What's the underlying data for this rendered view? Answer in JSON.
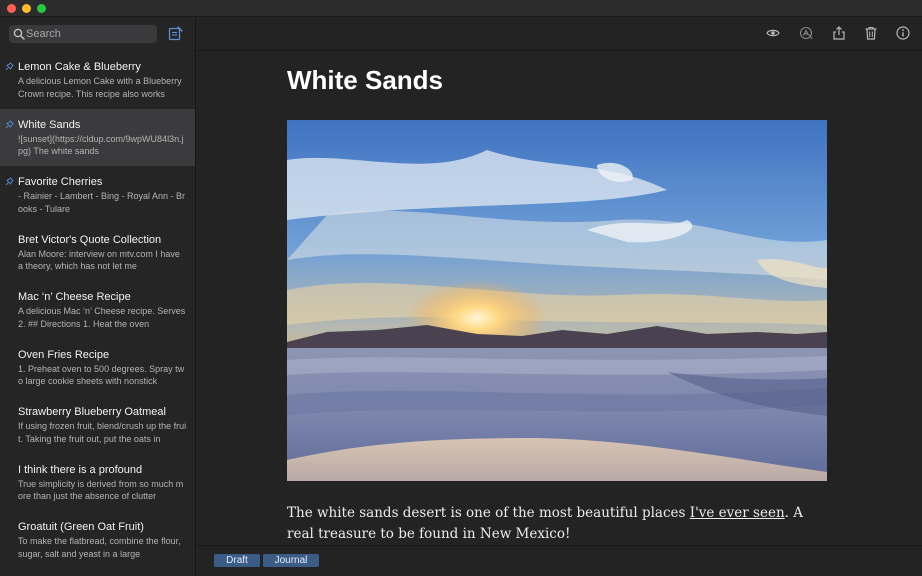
{
  "search": {
    "placeholder": "Search"
  },
  "notes": [
    {
      "title": "Lemon Cake & Blueberry",
      "preview": "A delicious Lemon Cake with a Blueberry Crown recipe. This recipe also works",
      "pinned": true,
      "selected": false
    },
    {
      "title": "White Sands",
      "preview": "![sunset](https://cldup.com/9wpWU84l3n.jpg) The white sands",
      "pinned": true,
      "selected": true
    },
    {
      "title": "Favorite Cherries",
      "preview": "- Rainier - Lambert - Bing - Royal Ann - Brooks - Tulare",
      "pinned": true,
      "selected": false
    },
    {
      "title": "Bret Victor's Quote Collection",
      "preview": "Alan Moore: interview on mtv.com  I have a theory, which has not let me",
      "pinned": false,
      "selected": false
    },
    {
      "title": "Mac ‘n’ Cheese Recipe",
      "preview": "A delicious Mac ‘n’ Cheese recipe. Serves 2. ## Directions 1. Heat the oven",
      "pinned": false,
      "selected": false
    },
    {
      "title": "Oven Fries Recipe",
      "preview": "1. Preheat oven to 500 degrees. Spray two large cookie sheets with nonstick",
      "pinned": false,
      "selected": false
    },
    {
      "title": "Strawberry Blueberry Oatmeal",
      "preview": "If using frozen fruit, blend/crush up the fruit. Taking the fruit out, put the oats in",
      "pinned": false,
      "selected": false
    },
    {
      "title": "I think there is a profound",
      "preview": "True simplicity is derived from so much more than just the absence of clutter",
      "pinned": false,
      "selected": false
    },
    {
      "title": "Groatuit (Green Oat Fruit)",
      "preview": "To make the flatbread, combine the flour, sugar, salt and yeast in a large",
      "pinned": false,
      "selected": false
    }
  ],
  "toolbar": {
    "icons": [
      "eye-icon",
      "markdown-icon",
      "share-icon",
      "trash-icon",
      "info-icon"
    ]
  },
  "editor": {
    "title": "White Sands",
    "image_icon": "sunset-photo",
    "body_before": "The white sands desert is one of the most beautiful places ",
    "body_link": "I've ever seen",
    "body_after": ". A real treasure to be found in New Mexico!"
  },
  "tags": [
    "Draft",
    "Journal"
  ],
  "colors": {
    "accent": "#3b5c86",
    "pin": "#5b8fd6",
    "selected_row": "#3b3b3d"
  }
}
